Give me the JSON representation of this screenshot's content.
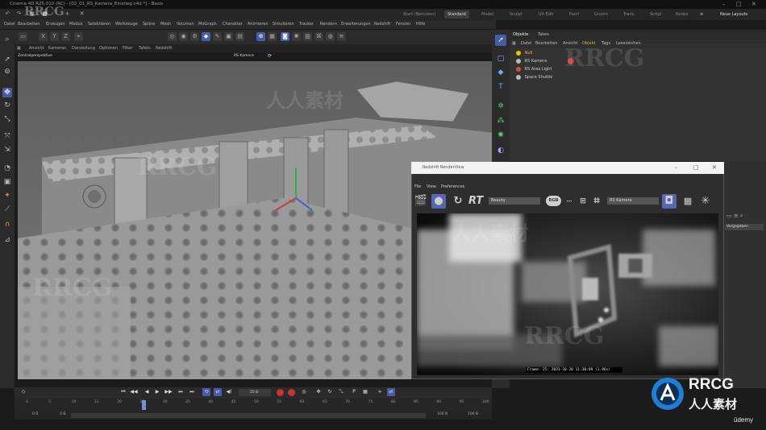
{
  "window": {
    "title": "Cinema 4D R25.010 (RC) - [02_01_RS_Kamera_Einstieg.c4d *] - Basis",
    "controls": [
      "–",
      "□",
      "✕"
    ]
  },
  "layout_tabs": [
    {
      "label": "Start (Benutzer)",
      "active": false
    },
    {
      "label": "Standard",
      "active": true
    },
    {
      "label": "Model",
      "active": false
    },
    {
      "label": "Sculpt",
      "active": false
    },
    {
      "label": "UV Edit",
      "active": false
    },
    {
      "label": "Paint",
      "active": false
    },
    {
      "label": "Groom",
      "active": false
    },
    {
      "label": "Track",
      "active": false
    },
    {
      "label": "Script",
      "active": false
    },
    {
      "label": "Nodes",
      "active": false
    }
  ],
  "new_layouts_label": "Neue Layouts",
  "menu": [
    "Datei",
    "Bearbeiten",
    "Erzeugen",
    "Modus",
    "Selektieren",
    "Werkzeuge",
    "Spline",
    "Mesh",
    "Volumen",
    "MoGraph",
    "Charakter",
    "Animieren",
    "Simulieren",
    "Tracker",
    "Rendern",
    "Erweiterungen",
    "Redshift",
    "Fenster",
    "Hilfe"
  ],
  "toolbar": {
    "axis_labels": [
      "X",
      "Y",
      "Z"
    ]
  },
  "viewport": {
    "menu": [
      "Ansicht",
      "Kameras",
      "Darstellung",
      "Optionen",
      "Filter",
      "Tafeln",
      "Redshift"
    ],
    "projection_label": "Zentralperspektive",
    "camera_label": "RS Kamera"
  },
  "object_manager": {
    "tabs": [
      "Objekte",
      "Takes"
    ],
    "menu": [
      "Datei",
      "Bearbeiten",
      "Ansicht",
      "Objekt",
      "Tags",
      "Lesezeichen"
    ],
    "objects": [
      {
        "name": "Null",
        "color": "#f0c000"
      },
      {
        "name": "RS Kamera",
        "color": "#bbbbbb"
      },
      {
        "name": "RS Area Light",
        "color": "#d84a3a"
      },
      {
        "name": "Space Shuttle",
        "color": "#bbbbbb"
      }
    ]
  },
  "attribute_panel": {
    "dropdown_value": "Vorgegeben"
  },
  "render_view": {
    "title": "Redshift RenderView",
    "menu": [
      "File",
      "View",
      "Preferences"
    ],
    "rt_label": "RT",
    "aov_value": "Beauty",
    "rgb_label": "RGB",
    "camera_value": "RS Kamera",
    "status": "Frame: 25: 2021-10-20  11:30:09  (1.96s)"
  },
  "timeline": {
    "current_frame": "25 B",
    "ruler_ticks": [
      "0",
      "5",
      "10",
      "15",
      "20",
      "25",
      "30",
      "35",
      "40",
      "45",
      "50",
      "55",
      "60",
      "65",
      "70",
      "75",
      "80",
      "85",
      "90",
      "95",
      "100"
    ],
    "range_start": "0 B",
    "range_mid": "0 B",
    "range_end": "100 B",
    "range_end2": "100 B",
    "playhead_frame": 25
  },
  "watermark": {
    "text": "RRCG",
    "cn_text": "人人素材"
  },
  "brand": {
    "logo_text": "RRCG",
    "logo_cn": "人人素材",
    "udemy": "ūdemy"
  }
}
